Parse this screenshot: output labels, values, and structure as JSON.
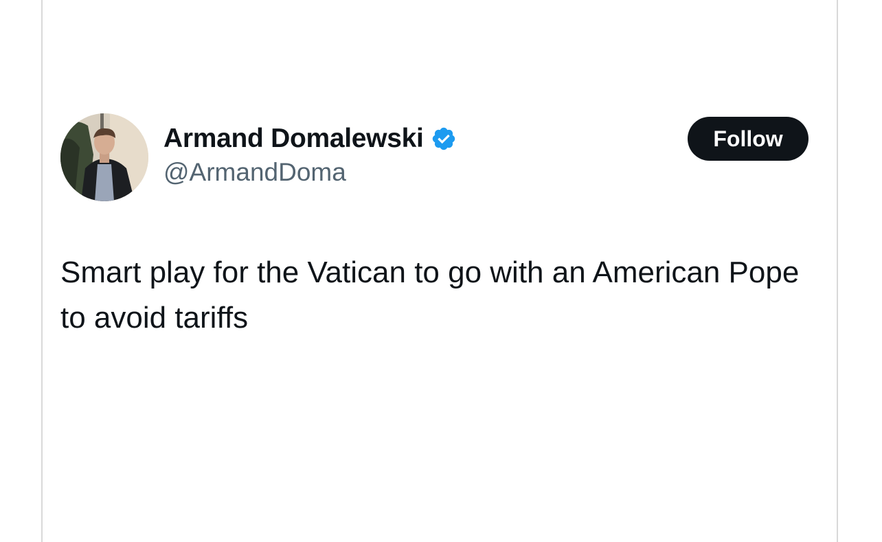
{
  "tweet": {
    "author": {
      "display_name": "Armand Domalewski",
      "handle": "@ArmandDoma",
      "verified": true,
      "avatar_icon": "profile-photo"
    },
    "follow_label": "Follow",
    "text": "Smart play for the Vatican to go with an American Pope to avoid tariffs"
  },
  "colors": {
    "text_primary": "#0f1419",
    "text_secondary": "#536471",
    "verified_blue": "#1d9bf0",
    "follow_bg": "#0f1419",
    "follow_text": "#ffffff",
    "card_border": "#d9d9d9"
  }
}
